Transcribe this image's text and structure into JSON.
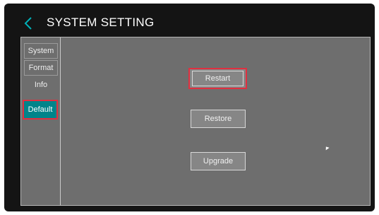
{
  "header": {
    "title": "SYSTEM SETTING",
    "back_icon": "chevron-left-icon",
    "accent_color": "#00b0b8"
  },
  "sidebar": {
    "tabs": [
      {
        "label": "System",
        "active": false
      },
      {
        "label": "Format",
        "active": false
      },
      {
        "label": "Info",
        "active": false
      },
      {
        "label": "Default",
        "active": true
      }
    ],
    "active_color": "#00848a",
    "highlight_color": "#e03040"
  },
  "main": {
    "buttons": [
      {
        "label": "Restart",
        "highlighted": true
      },
      {
        "label": "Restore",
        "highlighted": false
      },
      {
        "label": "Upgrade",
        "highlighted": false
      }
    ]
  }
}
